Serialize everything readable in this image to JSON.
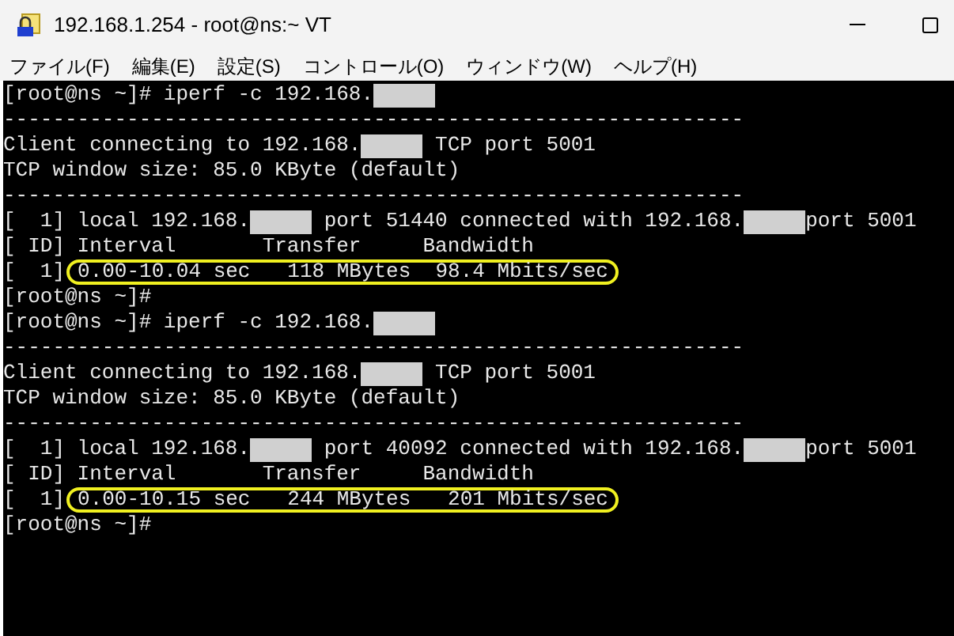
{
  "window": {
    "title": "192.168.1.254 - root@ns:~ VT"
  },
  "menu": [
    "ファイル(F)",
    "編集(E)",
    "設定(S)",
    "コントロール(O)",
    "ウィンドウ(W)",
    "ヘルプ(H)"
  ],
  "terminal": {
    "lines": [
      [
        {
          "kind": "text",
          "text": "[root@ns ~]# iperf -c 192.168."
        },
        {
          "kind": "mask"
        }
      ],
      [
        {
          "kind": "text",
          "text": "------------------------------------------------------------"
        }
      ],
      [
        {
          "kind": "text",
          "text": "Client connecting to 192.168."
        },
        {
          "kind": "mask"
        },
        {
          "kind": "text",
          "text": " TCP port 5001"
        }
      ],
      [
        {
          "kind": "text",
          "text": "TCP window size: 85.0 KByte (default)"
        }
      ],
      [
        {
          "kind": "text",
          "text": "------------------------------------------------------------"
        }
      ],
      [
        {
          "kind": "text",
          "text": "[  1] local 192.168."
        },
        {
          "kind": "mask"
        },
        {
          "kind": "text",
          "text": " port 51440 connected with 192.168."
        },
        {
          "kind": "mask"
        },
        {
          "kind": "text",
          "text": "port 5001"
        }
      ],
      [
        {
          "kind": "text",
          "text": "[ ID] Interval       Transfer     Bandwidth"
        }
      ],
      [
        {
          "kind": "text",
          "text": "[  1]"
        },
        {
          "kind": "circled",
          "text": "0.00-10.04 sec   118 MBytes  98.4 Mbits/sec"
        }
      ],
      [
        {
          "kind": "text",
          "text": "[root@ns ~]#"
        }
      ],
      [
        {
          "kind": "text",
          "text": "[root@ns ~]# iperf -c 192.168."
        },
        {
          "kind": "mask"
        }
      ],
      [
        {
          "kind": "text",
          "text": "------------------------------------------------------------"
        }
      ],
      [
        {
          "kind": "text",
          "text": "Client connecting to 192.168."
        },
        {
          "kind": "mask"
        },
        {
          "kind": "text",
          "text": " TCP port 5001"
        }
      ],
      [
        {
          "kind": "text",
          "text": "TCP window size: 85.0 KByte (default)"
        }
      ],
      [
        {
          "kind": "text",
          "text": "------------------------------------------------------------"
        }
      ],
      [
        {
          "kind": "text",
          "text": "[  1] local 192.168."
        },
        {
          "kind": "mask"
        },
        {
          "kind": "text",
          "text": " port 40092 connected with 192.168."
        },
        {
          "kind": "mask"
        },
        {
          "kind": "text",
          "text": "port 5001"
        }
      ],
      [
        {
          "kind": "text",
          "text": "[ ID] Interval       Transfer     Bandwidth"
        }
      ],
      [
        {
          "kind": "text",
          "text": "[  1]"
        },
        {
          "kind": "circled",
          "text": "0.00-10.15 sec   244 MBytes   201 Mbits/sec"
        }
      ],
      [
        {
          "kind": "text",
          "text": "[root@ns ~]#"
        }
      ]
    ]
  }
}
